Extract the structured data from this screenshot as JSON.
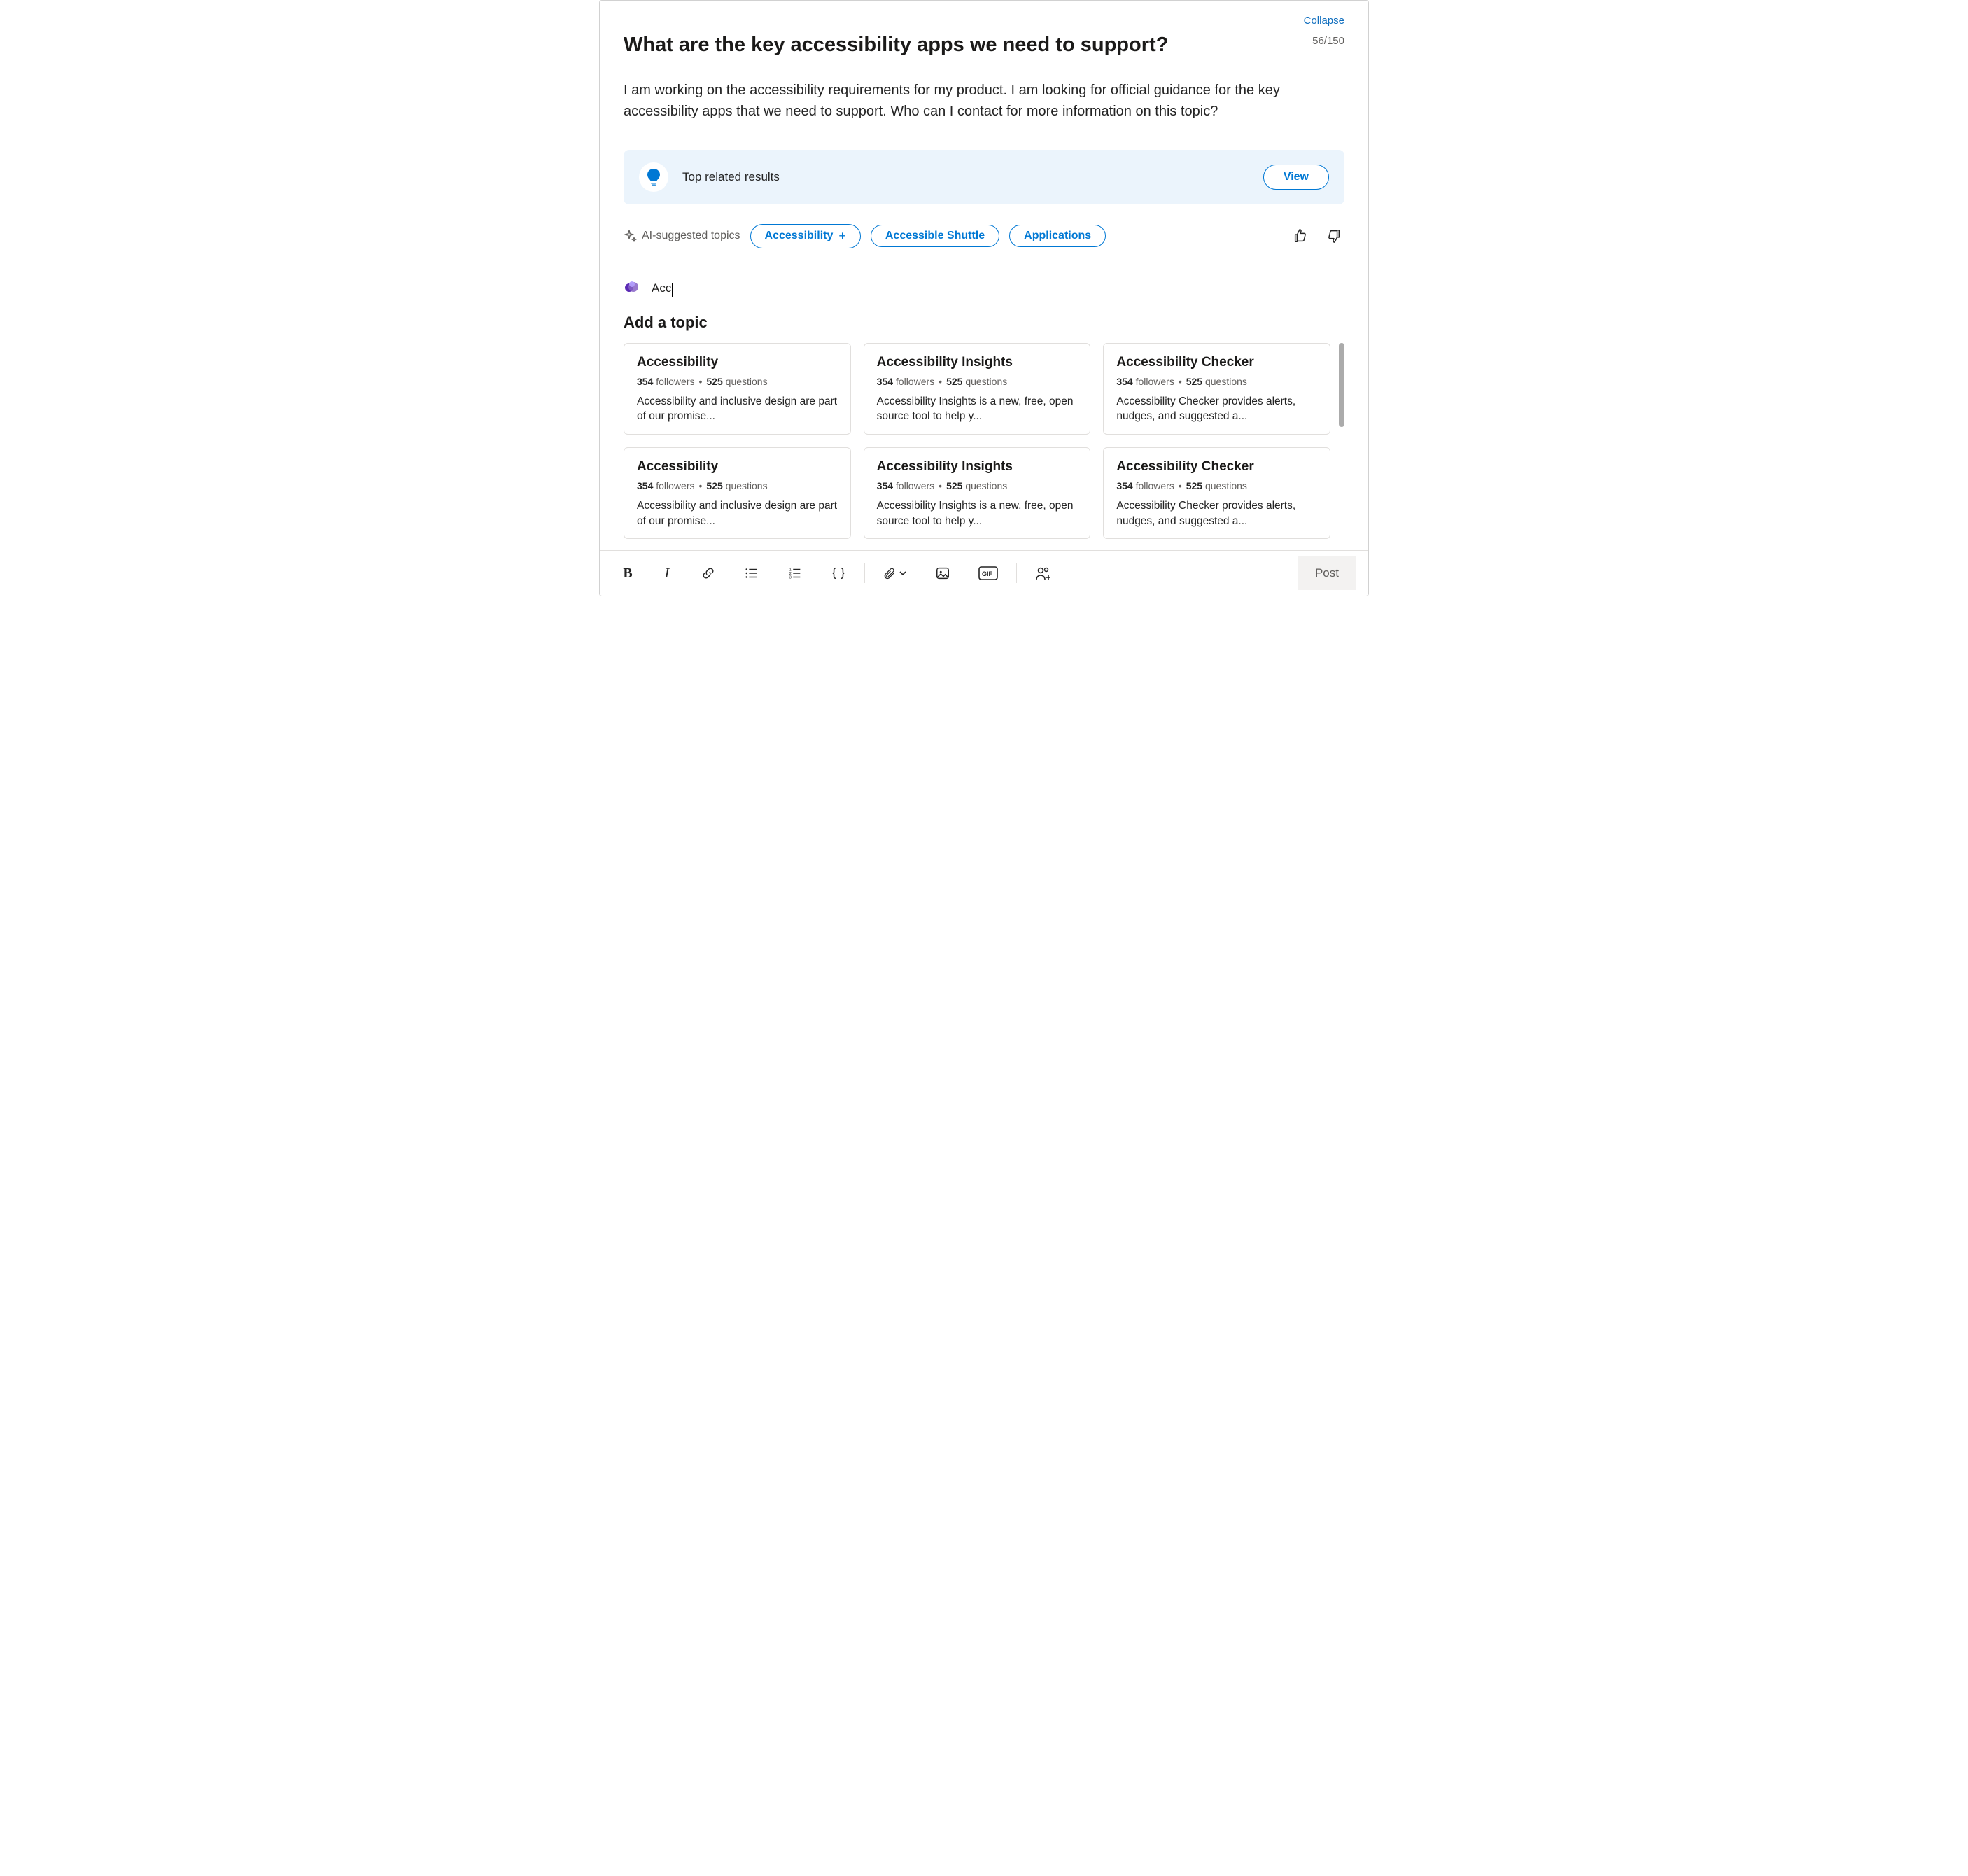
{
  "header": {
    "collapse": "Collapse",
    "title": "What are the key accessibility apps we need to support?",
    "counter": "56/150"
  },
  "body": "I am working on the accessibility requirements for my product. I am looking for official guidance for the key accessibility apps that we need to support. Who can I contact for more information on this topic?",
  "related": {
    "label": "Top related results",
    "view": "View"
  },
  "ai": {
    "label": "AI-suggested topics",
    "pills": [
      "Accessibility",
      "Accessible Shuttle",
      "Applications"
    ],
    "first_has_plus": true
  },
  "topic_input": {
    "value": "Acc"
  },
  "add_topic_heading": "Add a topic",
  "cards": [
    {
      "title": "Accessibility",
      "followers": "354",
      "questions": "525",
      "f_label": "followers",
      "q_label": "questions",
      "desc": "Accessibility and inclusive design are part of our promise..."
    },
    {
      "title": "Accessibility Insights",
      "followers": "354",
      "questions": "525",
      "f_label": "followers",
      "q_label": "questions",
      "desc": "Accessibility Insights is a new, free, open source tool to help y..."
    },
    {
      "title": "Accessibility Checker",
      "followers": "354",
      "questions": "525",
      "f_label": "followers",
      "q_label": "questions",
      "desc": "Accessibility Checker provides alerts, nudges, and suggested a..."
    },
    {
      "title": "Accessibility",
      "followers": "354",
      "questions": "525",
      "f_label": "followers",
      "q_label": "questions",
      "desc": "Accessibility and inclusive design are part of our promise..."
    },
    {
      "title": "Accessibility Insights",
      "followers": "354",
      "questions": "525",
      "f_label": "followers",
      "q_label": "questions",
      "desc": "Accessibility Insights is a new, free, open source tool to help y..."
    },
    {
      "title": "Accessibility Checker",
      "followers": "354",
      "questions": "525",
      "f_label": "followers",
      "q_label": "questions",
      "desc": "Accessibility Checker provides alerts, nudges, and suggested a..."
    }
  ],
  "toolbar": {
    "post": "Post"
  }
}
